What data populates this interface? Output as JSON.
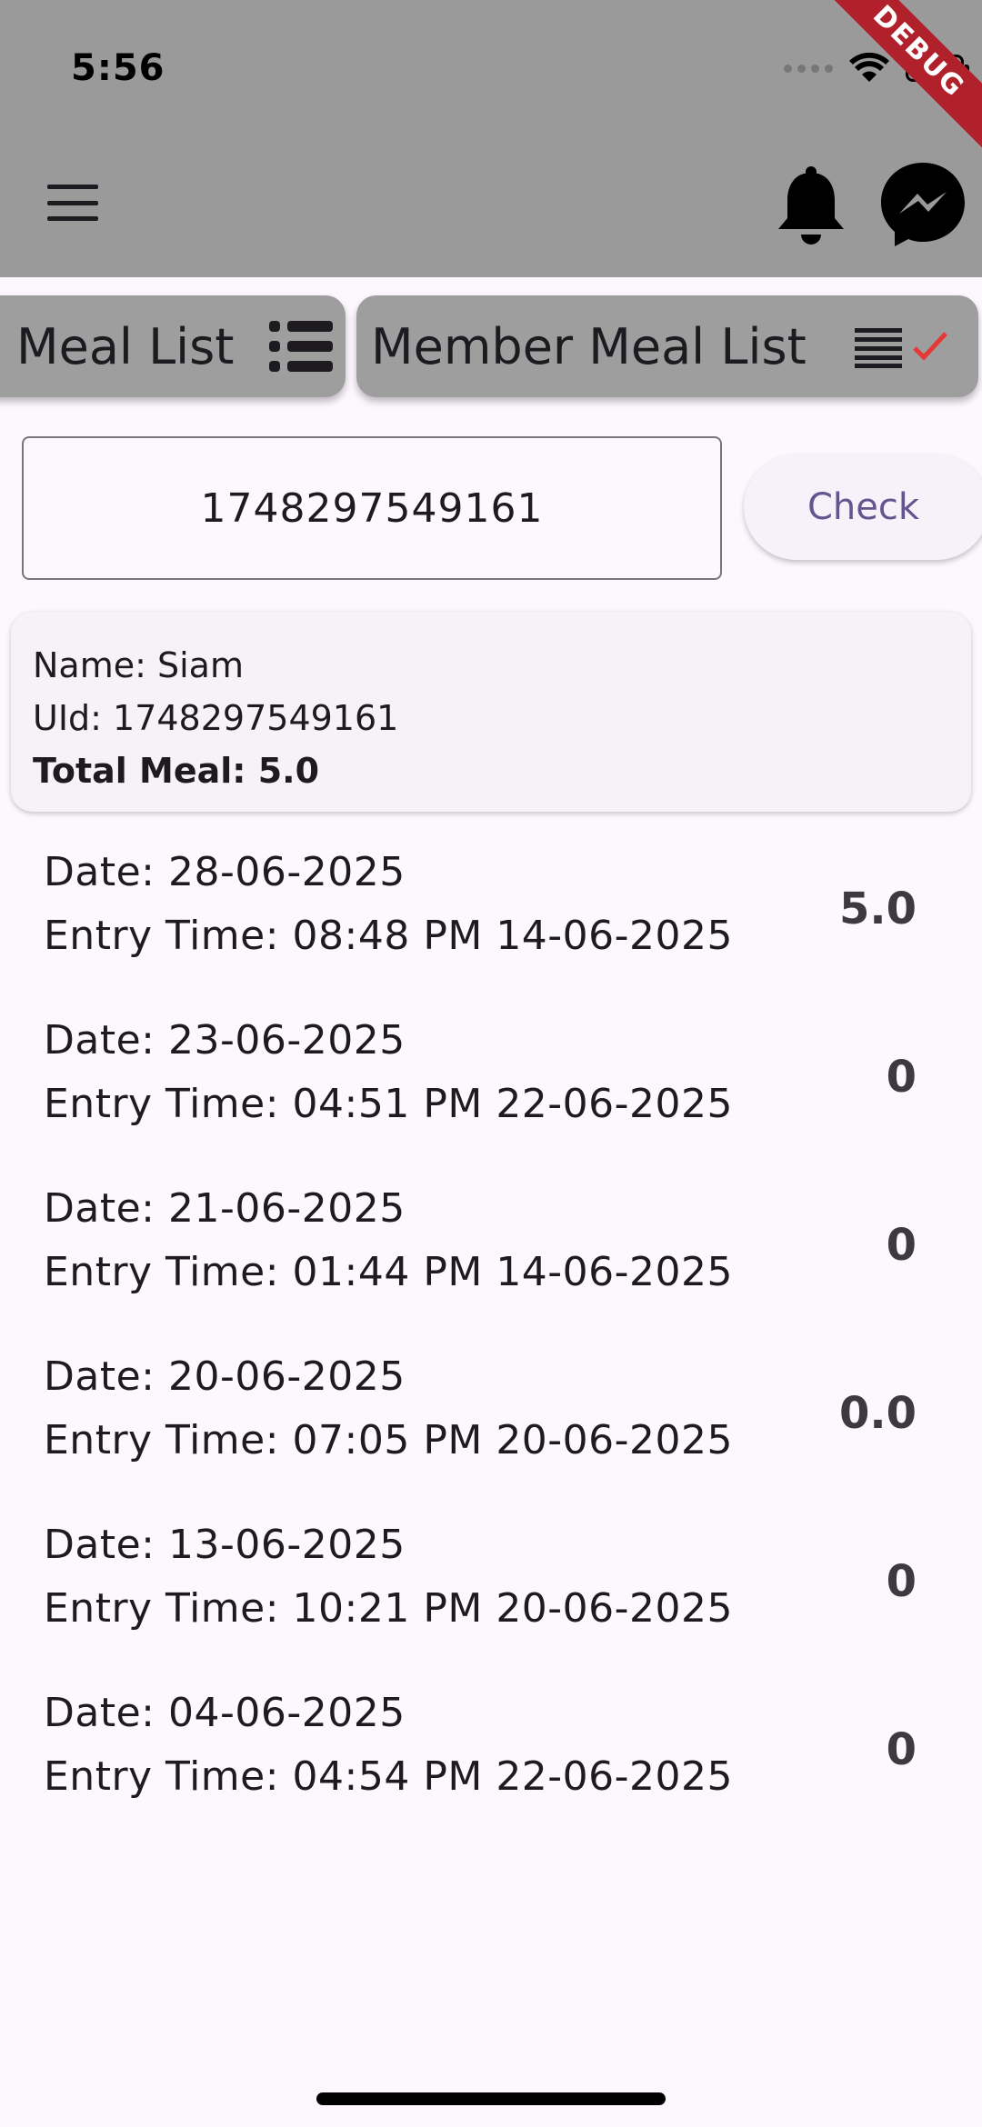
{
  "status_bar": {
    "time": "5:56"
  },
  "debug_banner": "DEBUG",
  "app_bar": {
    "menu_icon": "menu-icon",
    "notification_icon": "bell-icon",
    "chat_icon": "messenger-icon"
  },
  "tabs": [
    {
      "label": "Meal List",
      "icon": "list-icon"
    },
    {
      "label": "Member Meal List",
      "icon": "list-check-icon",
      "icon_accent": "#e53935"
    }
  ],
  "search": {
    "value": "1748297549161",
    "button_label": "Check"
  },
  "member": {
    "name_line": "Name: Siam",
    "uid_line": "UId: 1748297549161",
    "total_line": "Total Meal: 5.0"
  },
  "meals": [
    {
      "date": "Date: 28-06-2025",
      "entry": "Entry Time: 08:48 PM 14-06-2025",
      "count": "5.0"
    },
    {
      "date": "Date: 23-06-2025",
      "entry": "Entry Time: 04:51 PM 22-06-2025",
      "count": "0"
    },
    {
      "date": "Date: 21-06-2025",
      "entry": "Entry Time: 01:44 PM 14-06-2025",
      "count": "0"
    },
    {
      "date": "Date: 20-06-2025",
      "entry": "Entry Time: 07:05 PM 20-06-2025",
      "count": "0.0"
    },
    {
      "date": "Date: 13-06-2025",
      "entry": "Entry Time: 10:21 PM 20-06-2025",
      "count": "0"
    },
    {
      "date": "Date: 04-06-2025",
      "entry": "Entry Time: 04:54 PM 22-06-2025",
      "count": "0"
    }
  ],
  "colors": {
    "header_bg": "#9a9a9a",
    "page_bg": "#fdf7fe",
    "primary": "#65558f",
    "debug_red": "#b1212b"
  }
}
